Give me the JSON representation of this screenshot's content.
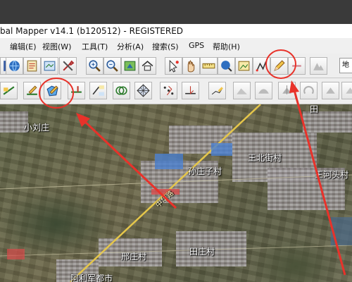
{
  "window": {
    "title": "bal Mapper v14.1 (b120512) - REGISTERED"
  },
  "menu": [
    {
      "label": "编辑(E)",
      "name": "menu-edit"
    },
    {
      "label": "视图(W)",
      "name": "menu-view"
    },
    {
      "label": "工具(T)",
      "name": "menu-tools"
    },
    {
      "label": "分析(A)",
      "name": "menu-analysis"
    },
    {
      "label": "搜索(S)",
      "name": "menu-search"
    },
    {
      "label": "GPS",
      "name": "menu-gps"
    },
    {
      "label": "帮助(H)",
      "name": "menu-help"
    }
  ],
  "toolbar": {
    "search_text": "地"
  },
  "map": {
    "labels": {
      "xiaoliuzhuang": "小刘庄",
      "wangbeijie": "王北街村",
      "wanghe": "王河头村",
      "liuzhuangzi": "孙庄子村",
      "xingzhuang": "邢庄村",
      "tianzhuang": "田庄村",
      "bottom": "阿利军都市",
      "top_right": "田",
      "road": "中华路"
    }
  },
  "colors": {
    "annotation_red": "#e8322a"
  }
}
